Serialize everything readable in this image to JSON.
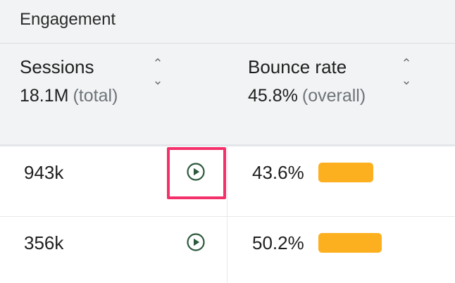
{
  "group": {
    "title": "Engagement"
  },
  "columns": {
    "sessions": {
      "title": "Sessions",
      "total": "18.1M",
      "total_label": "(total)"
    },
    "bounce": {
      "title": "Bounce rate",
      "total": "45.8%",
      "total_label": "(overall)"
    }
  },
  "sort_icons": {
    "up": "⌃",
    "down": "⌄"
  },
  "rows": [
    {
      "sessions": "943k",
      "bounce": "43.6%",
      "bounce_value": 43.6
    },
    {
      "sessions": "356k",
      "bounce": "50.2%",
      "bounce_value": 50.2
    }
  ],
  "colors": {
    "bar": "#fdb01f",
    "play_icon": "#2d5a3d",
    "highlight": "#f4306b"
  }
}
